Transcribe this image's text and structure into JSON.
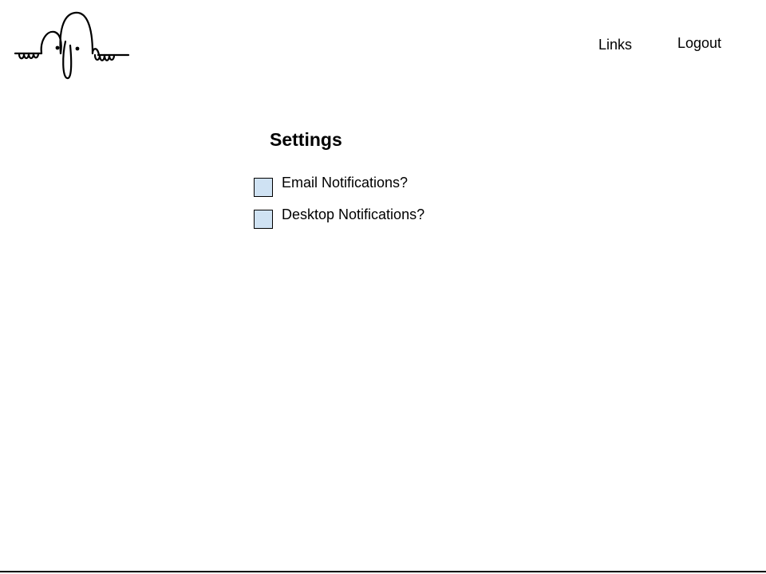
{
  "header": {
    "logo_icon": "peeking-creature-logo-icon",
    "nav": {
      "links_label": "Links",
      "logout_label": "Logout"
    }
  },
  "main": {
    "title": "Settings",
    "settings": [
      {
        "label": "Email Notifications?",
        "checked": false
      },
      {
        "label": "Desktop Notifications?",
        "checked": false
      }
    ]
  },
  "colors": {
    "checkbox_fill": "#cfe2f3",
    "text": "#000000",
    "background": "#ffffff"
  }
}
